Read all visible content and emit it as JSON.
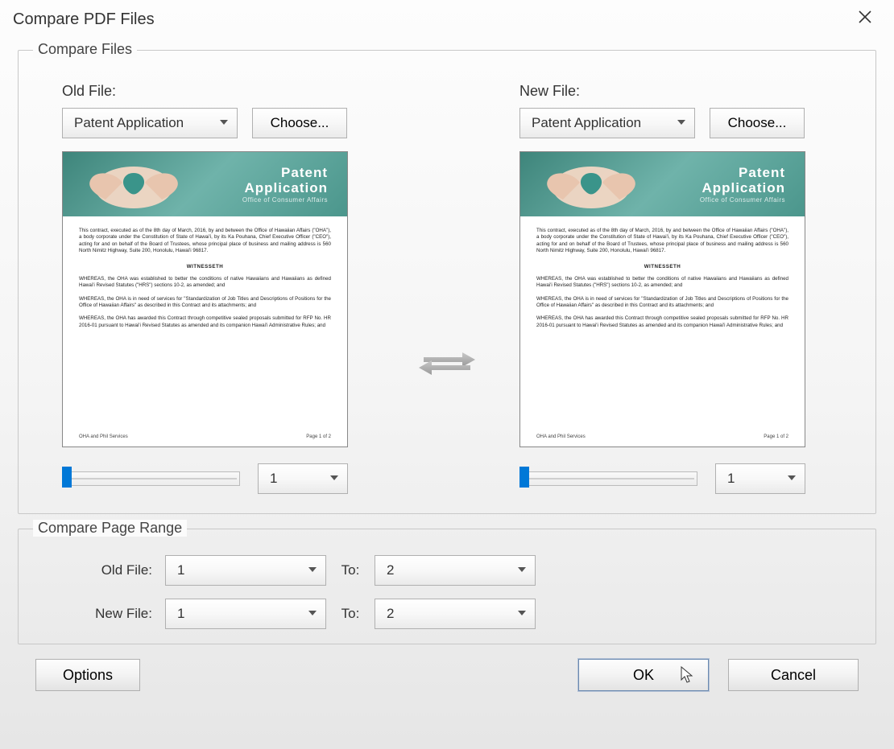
{
  "dialog": {
    "title": "Compare PDF Files"
  },
  "compare_files": {
    "legend": "Compare Files",
    "old": {
      "label": "Old File:",
      "selected": "Patent Application",
      "choose": "Choose...",
      "page": "1",
      "doc_title1": "Patent",
      "doc_title2": "Application"
    },
    "new": {
      "label": "New File:",
      "selected": "Patent Application",
      "choose": "Choose...",
      "page": "1",
      "doc_title1": "Patent",
      "doc_title2": "Application"
    }
  },
  "page_range": {
    "legend": "Compare Page Range",
    "old_label": "Old File:",
    "new_label": "New File:",
    "to_label": "To:",
    "old_from": "1",
    "old_to": "2",
    "new_from": "1",
    "new_to": "2"
  },
  "buttons": {
    "options": "Options",
    "ok": "OK",
    "cancel": "Cancel"
  }
}
